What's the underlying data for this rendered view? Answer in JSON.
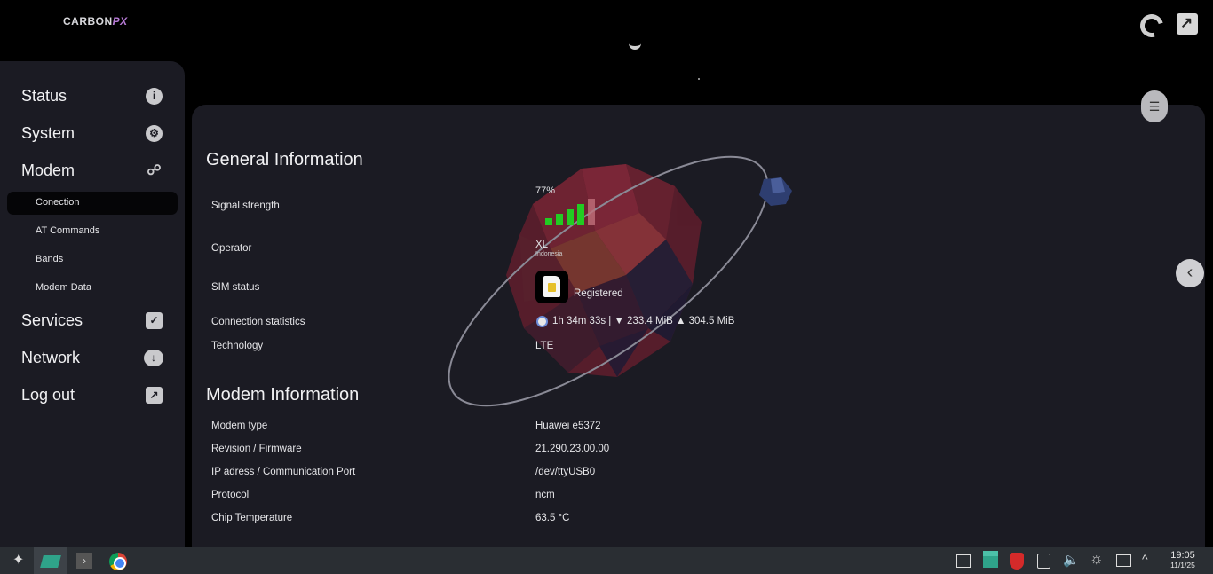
{
  "app": {
    "brand_main": "CARBON",
    "brand_accent": "PX"
  },
  "sidebar": {
    "items": [
      {
        "label": "Status",
        "icon": "info-icon"
      },
      {
        "label": "System",
        "icon": "gear-icon"
      },
      {
        "label": "Modem",
        "icon": "share-icon"
      },
      {
        "label": "Services",
        "icon": "checkbox-icon"
      },
      {
        "label": "Network",
        "icon": "cloud-download-icon"
      },
      {
        "label": "Log out",
        "icon": "logout-icon"
      }
    ],
    "modem_sub": [
      {
        "label": "Conection",
        "active": true
      },
      {
        "label": "AT Commands",
        "active": false
      },
      {
        "label": "Bands",
        "active": false
      },
      {
        "label": "Modem Data",
        "active": false
      }
    ]
  },
  "general": {
    "title": "General Information",
    "signal_label": "Signal strength",
    "signal_percent": "77%",
    "signal_level": 0.77,
    "operator_label": "Operator",
    "operator_name": "XL",
    "operator_country": "Indonesia",
    "sim_label": "SIM status",
    "sim_status": "Registered",
    "conn_label": "Connection statistics",
    "conn_value": "1h 34m 33s | ▼ 233.4 MiB ▲ 304.5 MiB",
    "tech_label": "Technology",
    "tech_value": "LTE"
  },
  "modem": {
    "title": "Modem Information",
    "rows": [
      {
        "label": "Modem type",
        "value": "Huawei e5372"
      },
      {
        "label": "Revision / Firmware",
        "value": "21.290.23.00.00"
      },
      {
        "label": "IP adress / Communication Port",
        "value": "/dev/ttyUSB0"
      },
      {
        "label": "Protocol",
        "value": "ncm"
      },
      {
        "label": "Chip Temperature",
        "value": "63.5 °C"
      }
    ]
  },
  "taskbar": {
    "time": "19:05",
    "date": "11/1/25"
  },
  "colors": {
    "signal_on": "#22cc22",
    "accent_brand": "#b77bd6",
    "panel_bg": "#1b1b23"
  }
}
